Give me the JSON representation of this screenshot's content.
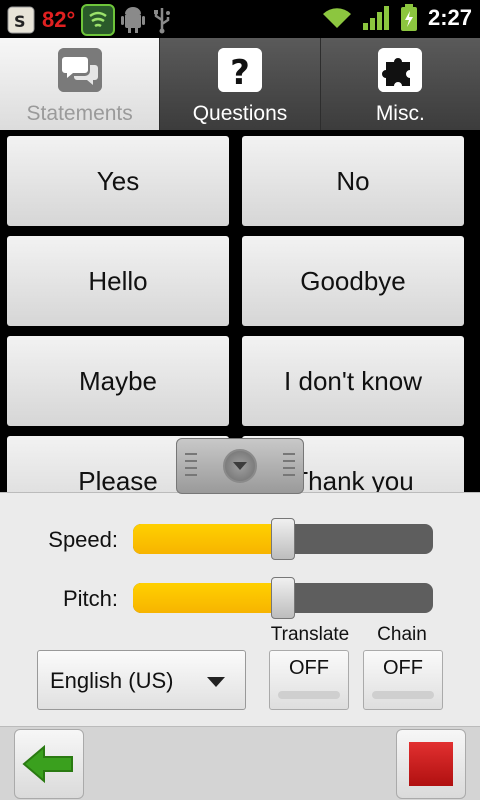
{
  "status_bar": {
    "temperature": "82°",
    "time": "2:27",
    "icons": [
      "weather-app-icon",
      "shield-icon",
      "android-debug-icon",
      "usb-icon",
      "wifi-icon",
      "signal-icon",
      "battery-charging-icon"
    ],
    "colors": {
      "temperature": "#e02020",
      "network": "#8cc63f"
    }
  },
  "tabs": [
    {
      "label": "Statements",
      "icon": "speech-bubbles-icon",
      "selected": true
    },
    {
      "label": "Questions",
      "icon": "question-mark-icon",
      "selected": false
    },
    {
      "label": "Misc.",
      "icon": "puzzle-piece-icon",
      "selected": false
    }
  ],
  "phrases": [
    "Yes",
    "No",
    "Hello",
    "Goodbye",
    "Maybe",
    "I don't know",
    "Please",
    "Thank you"
  ],
  "controls": {
    "speed": {
      "label": "Speed:",
      "level_percent": 50
    },
    "pitch": {
      "label": "Pitch:",
      "level_percent": 50
    },
    "language": {
      "selected": "English (US)"
    },
    "translate": {
      "caption": "Translate",
      "state": "OFF"
    },
    "chain": {
      "caption": "Chain",
      "state": "OFF"
    }
  },
  "bottom": {
    "back_icon": "green-left-arrow-icon",
    "stop_icon": "red-stop-square-icon",
    "colors": {
      "back": "#3aa01e",
      "stop": "#cc2020",
      "slider_fill": "#fcc200"
    }
  }
}
